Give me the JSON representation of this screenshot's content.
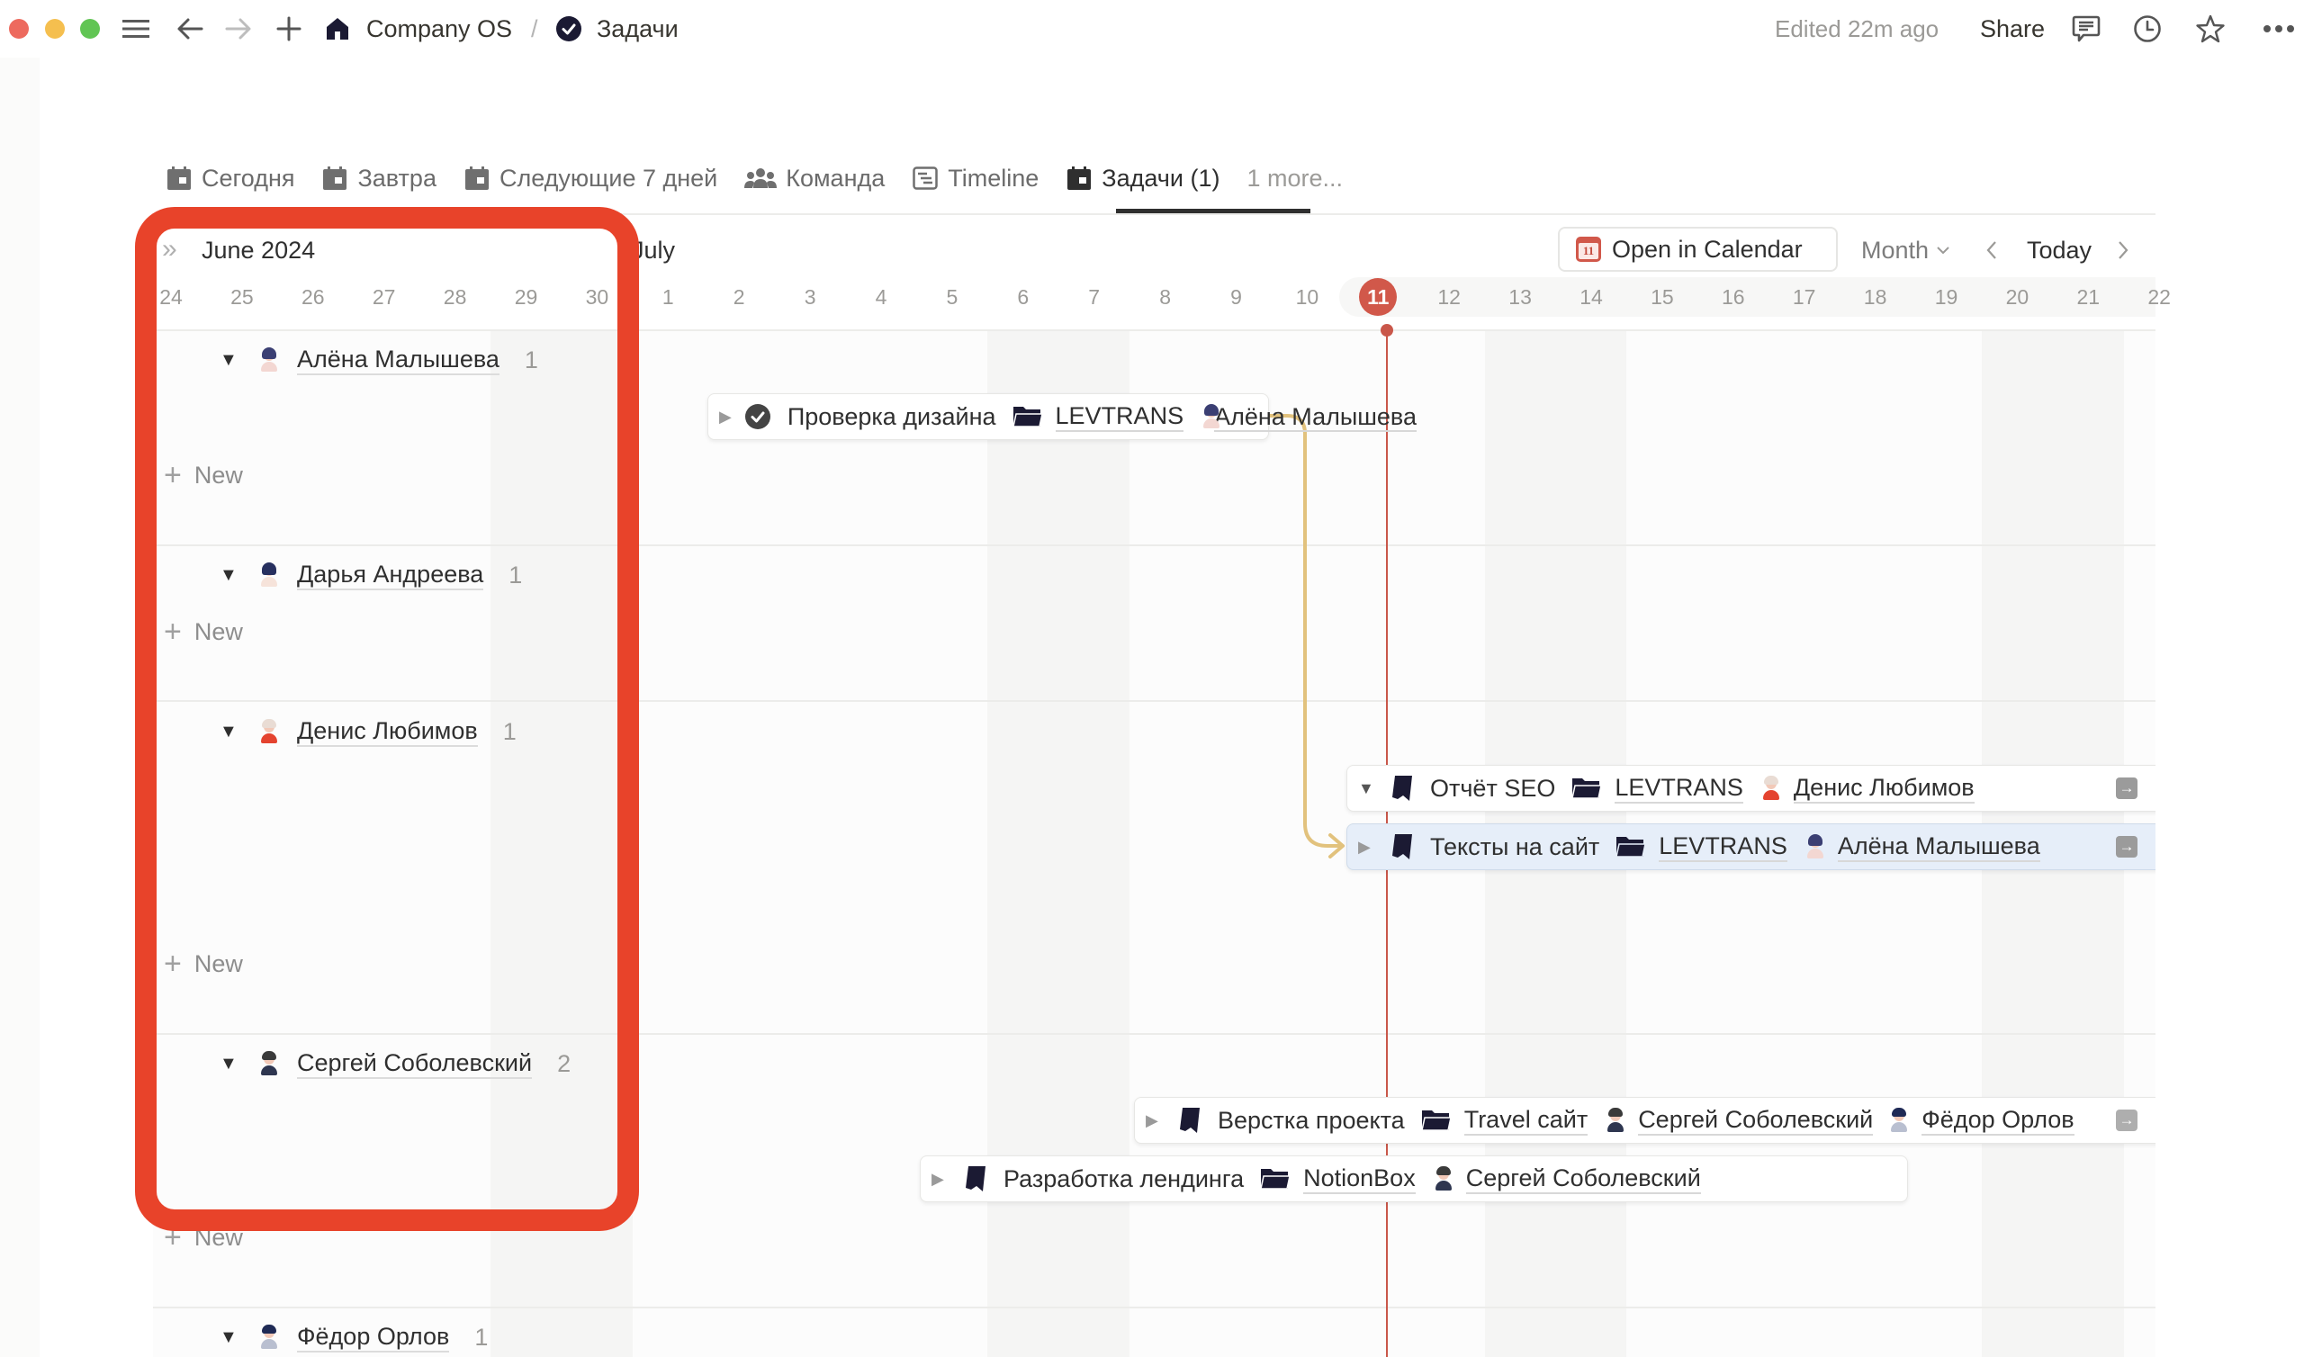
{
  "window": {
    "breadcrumb": [
      {
        "label": "Company OS",
        "icon": "house-icon"
      },
      {
        "label": "Задачи",
        "icon": "check-circle-icon"
      }
    ],
    "breadcrumb_separator": "/",
    "edited": "Edited 22m ago",
    "share_label": "Share",
    "toolbar_icons": [
      "comments-icon",
      "history-icon",
      "favorite-star-icon",
      "more-icon"
    ]
  },
  "tabs": {
    "items": [
      {
        "label": "Сегодня",
        "icon": "calendar-icon",
        "active": false
      },
      {
        "label": "Завтра",
        "icon": "calendar-icon",
        "active": false
      },
      {
        "label": "Следующие 7 дней",
        "icon": "calendar-icon",
        "active": false
      },
      {
        "label": "Команда",
        "icon": "people-icon",
        "active": false
      },
      {
        "label": "Timeline",
        "icon": "timeline-icon",
        "active": false
      },
      {
        "label": "Задачи (1)",
        "icon": "calendar-icon",
        "active": true
      }
    ],
    "more_label": "1 more..."
  },
  "timeline": {
    "month_left": "June 2024",
    "month_right": "July",
    "open_calendar_label": "Open in Calendar",
    "calendar_icon_day": "11",
    "range_select": "Month",
    "today_label": "Today",
    "days": [
      "24",
      "25",
      "26",
      "27",
      "28",
      "29",
      "30",
      "1",
      "2",
      "3",
      "4",
      "5",
      "6",
      "7",
      "8",
      "9",
      "10",
      "11",
      "12",
      "13",
      "14",
      "15",
      "16",
      "17",
      "18",
      "19",
      "20",
      "21",
      "22"
    ],
    "today_index": 17,
    "weekend_indices": [
      5,
      6,
      12,
      13,
      19,
      20,
      26,
      27
    ]
  },
  "groups": [
    {
      "name": "Алёна Малышева",
      "count": "1",
      "new_label": "New"
    },
    {
      "name": "Дарья Андреева",
      "count": "1",
      "new_label": "New"
    },
    {
      "name": "Денис Любимов",
      "count": "1",
      "new_label": "New"
    },
    {
      "name": "Сергей Соболевский",
      "count": "2",
      "new_label": "New"
    },
    {
      "name": "Фёдор Орлов",
      "count": "1"
    }
  ],
  "tasks": [
    {
      "title": "Проверка дизайна",
      "status_icon": "check-circle-icon",
      "project": "LEVTRANS",
      "assignees": [
        "Алёна Малышева"
      ],
      "expanded": false,
      "selected": false
    },
    {
      "title": "Отчёт SEO",
      "status_icon": "bookmark-icon",
      "project": "LEVTRANS",
      "assignees": [
        "Денис Любимов"
      ],
      "expanded": true,
      "selected": false
    },
    {
      "title": "Тексты на сайт",
      "status_icon": "bookmark-icon",
      "project": "LEVTRANS",
      "assignees": [
        "Алёна Малышева"
      ],
      "expanded": false,
      "selected": true
    },
    {
      "title": "Верстка проекта",
      "status_icon": "bookmark-icon",
      "project": "Travel сайт",
      "assignees": [
        "Сергей Соболевский",
        "Фёдор Орлов"
      ],
      "expanded": false,
      "selected": false
    },
    {
      "title": "Разработка лендинга",
      "status_icon": "bookmark-icon",
      "project": "NotionBox",
      "assignees": [
        "Сергей Соболевский"
      ],
      "expanded": false,
      "selected": false
    }
  ],
  "colors": {
    "today": "#d1584a",
    "highlight": "#e8432a",
    "dependency": "#e2c27d",
    "selected_bar": "#e6eef9"
  }
}
